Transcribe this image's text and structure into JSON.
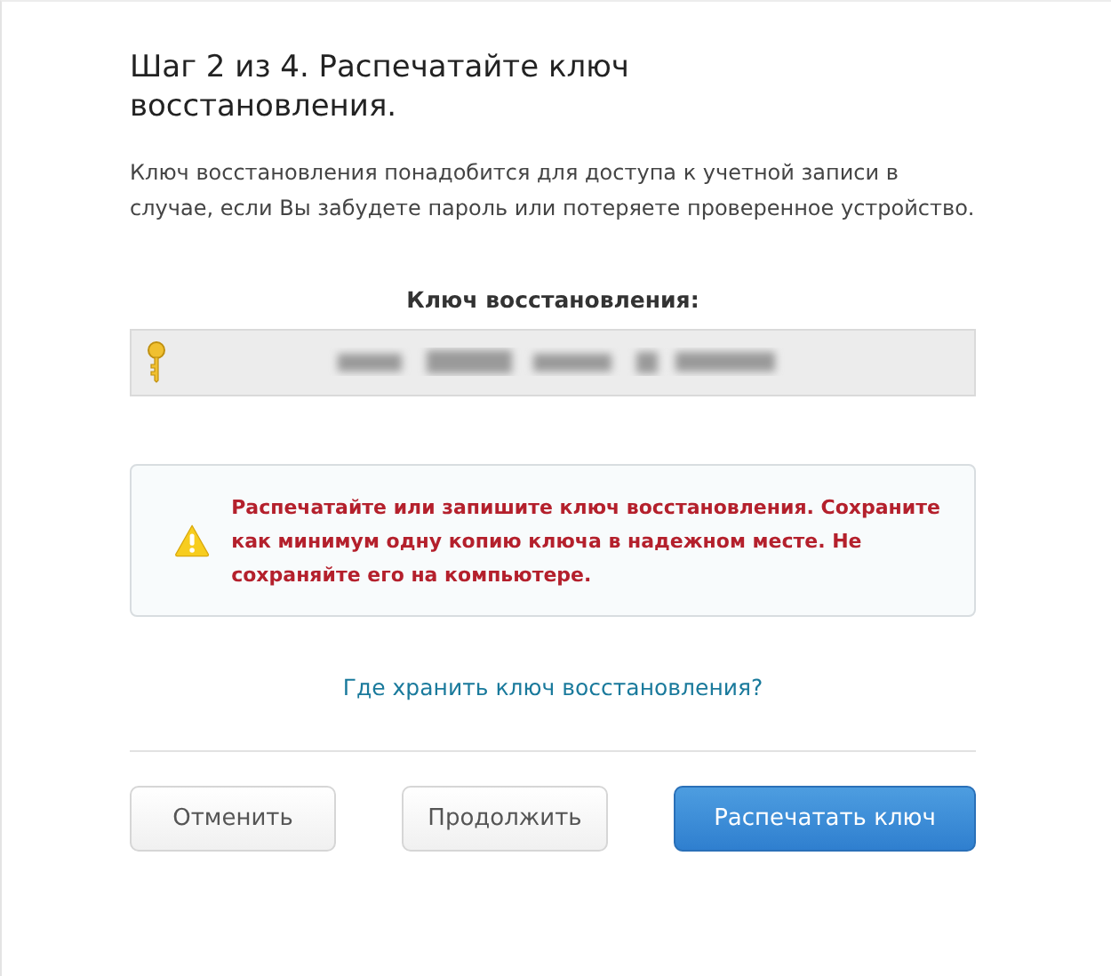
{
  "title": "Шаг 2 из 4. Распечатайте ключ восстановления.",
  "description": "Ключ восстановления понадобится для доступа к учетной записи в случае, если Вы забудете пароль или потеряете проверенное устройство.",
  "key_label": "Ключ восстановления:",
  "warning": "Распечатайте или запишите ключ восстановления. Сохраните как минимум одну копию ключа в надежном месте. Не сохраняйте его на компьютере.",
  "help_link": "Где хранить ключ восстановления?",
  "buttons": [
    {
      "label": "Отменить",
      "kind": "default"
    },
    {
      "label": "Продолжить",
      "kind": "default"
    },
    {
      "label": "Распечатать ключ",
      "kind": "primary"
    }
  ]
}
